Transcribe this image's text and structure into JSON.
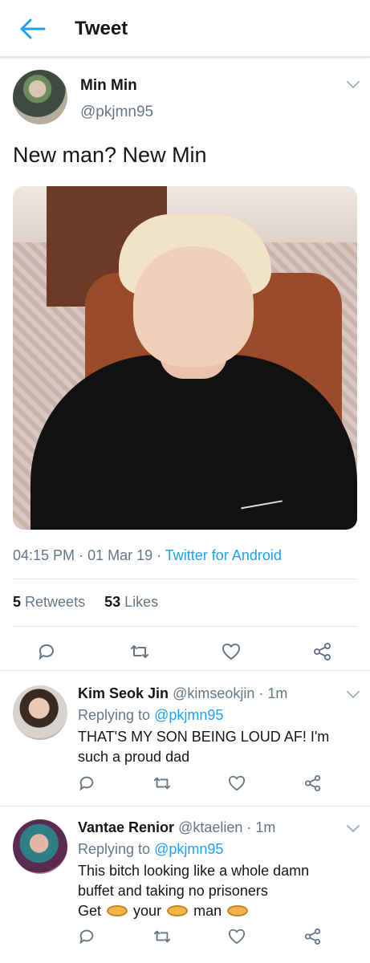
{
  "header": {
    "title": "Tweet"
  },
  "tweet": {
    "author_name": "Min Min",
    "author_handle": "@pkjmn95",
    "text": "New man? New Min",
    "time": "04:15 PM",
    "date": "01 Mar 19",
    "client": "Twitter for Android",
    "retweet_count": "5",
    "retweet_label": "Retweets",
    "like_count": "53",
    "like_label": "Likes"
  },
  "replies": [
    {
      "name": "Kim Seok Jin",
      "handle": "@kimseokjin",
      "time": "1m",
      "replying_prefix": "Replying to",
      "replying_to": "@pkjmn95",
      "text": "THAT'S MY SON BEING LOUD AF! I'm such a proud dad"
    },
    {
      "name": "Vantae Renior",
      "handle": "@ktaelien",
      "time": "1m",
      "replying_prefix": "Replying to",
      "replying_to": "@pkjmn95",
      "text_line1": "This bitch looking like a whole damn",
      "text_line2": "buffet and taking no prisoners",
      "word_get": "Get",
      "word_your": "your",
      "word_man": "man"
    }
  ],
  "icons": {
    "back": "back-arrow-icon",
    "reply": "reply-icon",
    "retweet": "retweet-icon",
    "like": "heart-icon",
    "share": "share-icon",
    "caret": "chevron-down-icon",
    "emoji": "emoji-icon"
  },
  "colors": {
    "accent": "#1da1f2",
    "text": "#14171a",
    "secondary_text": "#657786",
    "border": "#e1e8ed"
  }
}
